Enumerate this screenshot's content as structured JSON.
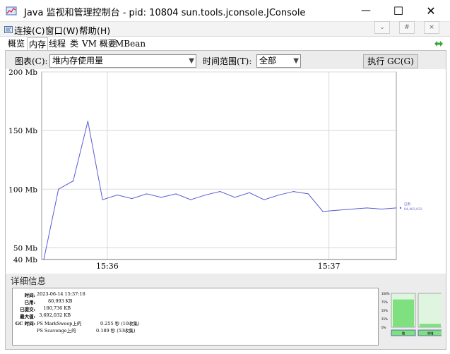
{
  "window": {
    "title": "Java 监视和管理控制台 - pid: 10804 sun.tools.jconsole.JConsole",
    "minimize_glyph": "—",
    "maximize_glyph": "☐",
    "close_glyph": "✕"
  },
  "menu": {
    "items": [
      "连接(C)",
      "窗口(W)",
      "帮助(H)"
    ],
    "mdi_buttons": [
      "⌄",
      "#",
      "×"
    ]
  },
  "tabs": {
    "items": [
      "概览",
      "内存",
      "线程",
      "类",
      "VM 概要",
      "MBean"
    ],
    "active_index": 1
  },
  "controls": {
    "chart_label": "图表(C):",
    "chart_value": "堆内存使用量",
    "time_label": "时间范围(T):",
    "time_value": "全部",
    "gc_button": "执行 GC(G)"
  },
  "chart_data": {
    "type": "line",
    "y_ticks": [
      "200 Mb",
      "150 Mb",
      "100 Mb",
      "50 Mb",
      "40 Mb"
    ],
    "x_ticks": [
      "15:36",
      "15:37"
    ],
    "ylim": [
      40,
      200
    ],
    "grid": true,
    "series": [
      {
        "name": "已用",
        "color": "#5b5bd6",
        "values": [
          40,
          100,
          107,
          158,
          91,
          95,
          92,
          96,
          93,
          96,
          91,
          95,
          98,
          93,
          97,
          91,
          95,
          98,
          96,
          81,
          82,
          83,
          84,
          83,
          84
        ]
      }
    ],
    "end_label_name": "已用",
    "end_label_value": "84,483,032"
  },
  "details": {
    "title": "详细信息",
    "rows": [
      {
        "key": "时间:",
        "value": "2023-06-14 15:37:18"
      },
      {
        "key": "已用:",
        "value": "80,993 KB"
      },
      {
        "key": "已提交:",
        "value": "180,736 KB"
      },
      {
        "key": "最大值:",
        "value": "3,692,032 KB"
      }
    ],
    "gc_key": "GC 时间:",
    "gc_rows": [
      {
        "name": "PS MarkSweep上的",
        "value": "0.255 秒 (10收集)"
      },
      {
        "name": "PS Scavenge上的",
        "value": "0.189 秒 (53收集)"
      }
    ]
  },
  "pool_bars": {
    "scale_labels": [
      "100%",
      "75%",
      "50%",
      "25%",
      "0%"
    ],
    "bars": [
      {
        "label": "堆",
        "fill": 0.82
      },
      {
        "label": "非堆",
        "fill": 0.1
      }
    ],
    "fill_color": "#7ee07e",
    "empty_color": "#dff5df"
  }
}
